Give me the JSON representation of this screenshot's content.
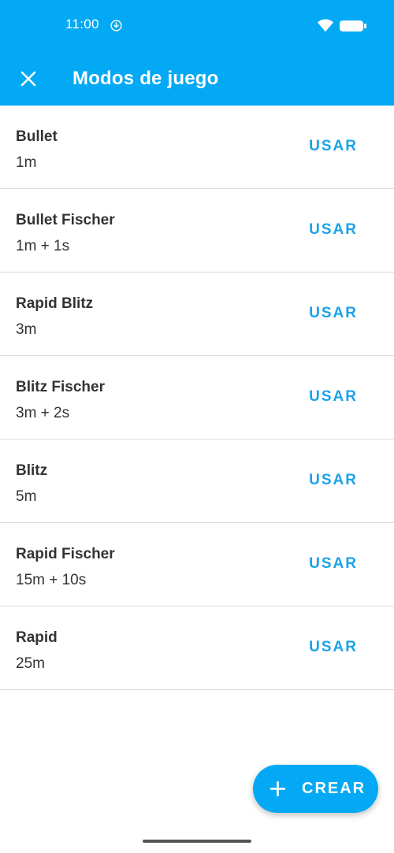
{
  "status_bar": {
    "time": "11:00",
    "sync_icon": "sync-download-icon",
    "wifi_icon": "wifi-icon",
    "battery_icon": "battery-full-icon"
  },
  "app_bar": {
    "close_icon": "close-icon",
    "title": "Modos de juego"
  },
  "modes": [
    {
      "name": "Bullet",
      "time": "1m",
      "action": "USAR"
    },
    {
      "name": "Bullet Fischer",
      "time": "1m + 1s",
      "action": "USAR"
    },
    {
      "name": "Rapid Blitz",
      "time": "3m",
      "action": "USAR"
    },
    {
      "name": "Blitz Fischer",
      "time": "3m + 2s",
      "action": "USAR"
    },
    {
      "name": "Blitz",
      "time": "5m",
      "action": "USAR"
    },
    {
      "name": "Rapid Fischer",
      "time": "15m + 10s",
      "action": "USAR"
    },
    {
      "name": "Rapid",
      "time": "25m",
      "action": "USAR"
    }
  ],
  "fab": {
    "icon": "plus-icon",
    "label": "CREAR"
  },
  "colors": {
    "primary": "#03a9f4",
    "accent_text": "#1aa3ea",
    "item_text": "#333333",
    "divider": "#dcdcdc"
  }
}
